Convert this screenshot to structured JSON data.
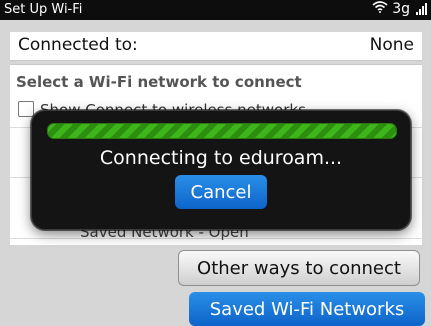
{
  "status_bar": {
    "title": "Set Up Wi-Fi",
    "network": "3g",
    "icons": [
      "wifi-icon",
      "signal-icon"
    ]
  },
  "connected": {
    "label": "Connected to:",
    "value": "None"
  },
  "network_list": {
    "heading": "Select a Wi-Fi network to connect",
    "hidden_network_label": "Show Connect to wireless networks",
    "saved_network_subtitle": "Saved Network - Open"
  },
  "buttons": {
    "other_ways": "Other ways to connect",
    "saved_networks": "Saved Wi-Fi Networks"
  },
  "dialog": {
    "message": "Connecting to eduroam...",
    "cancel": "Cancel"
  },
  "colors": {
    "accent": "#1a78dc",
    "progress": "#3db51b",
    "wifi_green": "#48c21e"
  }
}
